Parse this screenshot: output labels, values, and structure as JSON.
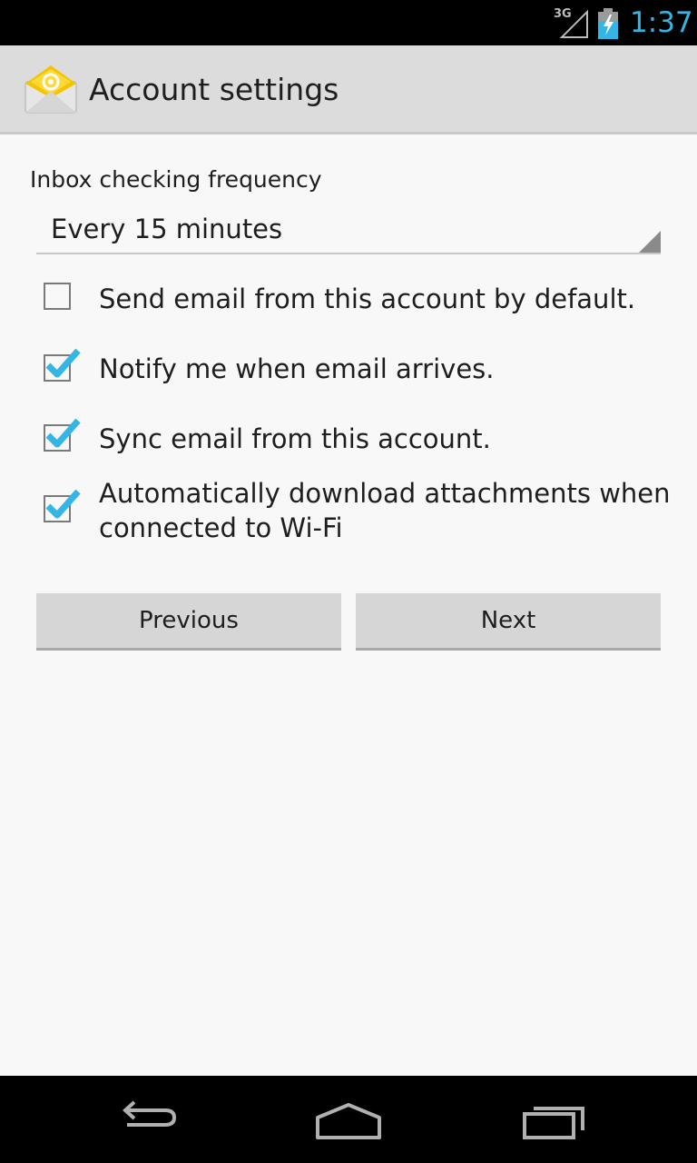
{
  "status_bar": {
    "network": "3G",
    "time": "1:37",
    "icons": [
      "signal-icon",
      "battery-charging-icon"
    ],
    "time_color": "#33b5e5"
  },
  "action_bar": {
    "title": "Account settings",
    "icon": "email-app-icon"
  },
  "settings": {
    "frequency_label": "Inbox checking frequency",
    "frequency_value": "Every 15 minutes",
    "options": [
      {
        "label": "Send email from this account by default.",
        "checked": false
      },
      {
        "label": "Notify me when email arrives.",
        "checked": true
      },
      {
        "label": "Sync email from this account.",
        "checked": true
      },
      {
        "label": "Automatically download attachments when connected to Wi-Fi",
        "checked": true
      }
    ]
  },
  "buttons": {
    "previous": "Previous",
    "next": "Next"
  },
  "nav_bar": {
    "icons": [
      "back-icon",
      "home-icon",
      "recent-apps-icon"
    ]
  },
  "colors": {
    "accent": "#33b5e5",
    "background": "#f8f8f8",
    "action_bar": "#dcdcdc"
  }
}
